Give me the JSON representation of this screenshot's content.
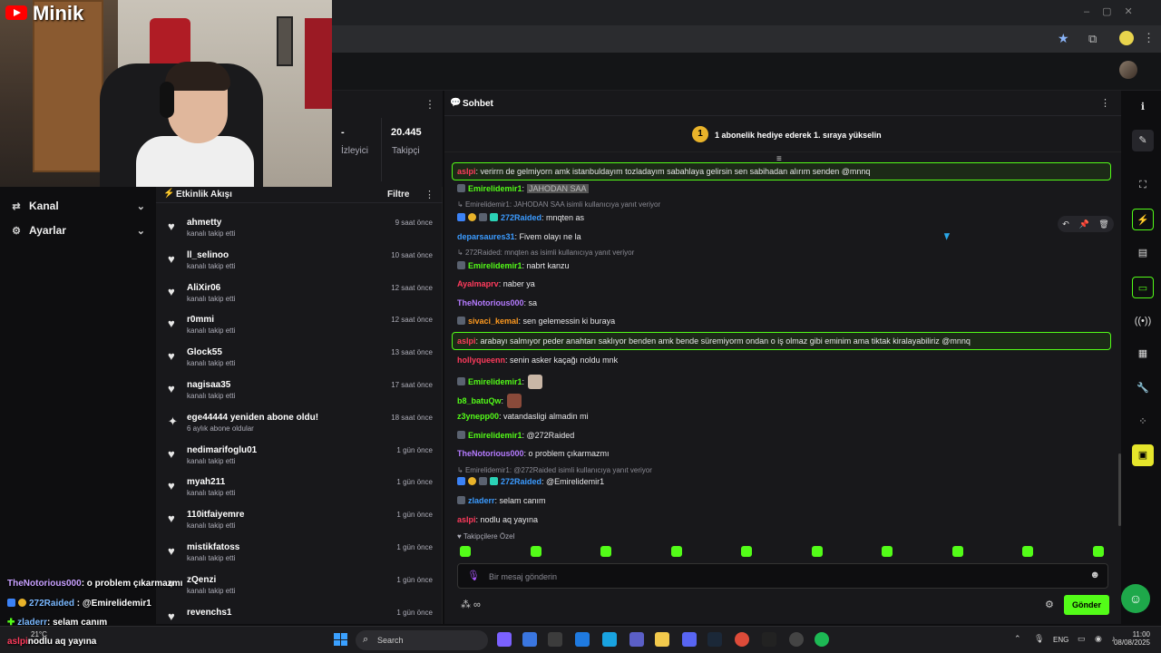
{
  "overlay": {
    "channel_name": "Minik",
    "chat_lines": [
      {
        "user": "TheNotorious000",
        "text": ": o problem çıkarmazmı"
      },
      {
        "user": "272Raided",
        "text": " : @Emirelidemir1"
      },
      {
        "user": "zladerr",
        "text": ": selam canım"
      },
      {
        "user": "aslpi",
        "text": "nodlu aq yayına"
      }
    ],
    "weather": "21°C"
  },
  "sidebar": {
    "items": [
      {
        "label": "Kanal"
      },
      {
        "label": "Ayarlar"
      }
    ]
  },
  "stats": {
    "viewers_value": "-",
    "viewers_label": "İzleyici",
    "followers_value": "20.445",
    "followers_label": "Takipçi"
  },
  "activity": {
    "title": "Etkinlik Akışı",
    "filter_label": "Filtre",
    "items": [
      {
        "name": "ahmetty",
        "sub": "kanalı takip etti",
        "time": "9 saat önce",
        "icon": "heart-icon"
      },
      {
        "name": "ll_selinoo",
        "sub": "kanalı takip etti",
        "time": "10 saat önce",
        "icon": "heart-icon"
      },
      {
        "name": "AliXir06",
        "sub": "kanalı takip etti",
        "time": "12 saat önce",
        "icon": "heart-icon"
      },
      {
        "name": "r0mmi",
        "sub": "kanalı takip etti",
        "time": "12 saat önce",
        "icon": "heart-icon"
      },
      {
        "name": "Glock55",
        "sub": "kanalı takip etti",
        "time": "13 saat önce",
        "icon": "heart-icon"
      },
      {
        "name": "nagisaa35",
        "sub": "kanalı takip etti",
        "time": "17 saat önce",
        "icon": "heart-icon"
      },
      {
        "name": "ege44444 yeniden abone oldu!",
        "sub": "6 aylık abone oldular",
        "time": "18 saat önce",
        "icon": "sparkle-icon"
      },
      {
        "name": "nedimarifoglu01",
        "sub": "kanalı takip etti",
        "time": "1 gün önce",
        "icon": "heart-icon"
      },
      {
        "name": "myah211",
        "sub": "kanalı takip etti",
        "time": "1 gün önce",
        "icon": "heart-icon"
      },
      {
        "name": "110itfaiyemre",
        "sub": "kanalı takip etti",
        "time": "1 gün önce",
        "icon": "heart-icon"
      },
      {
        "name": "mistikfatoss",
        "sub": "kanalı takip etti",
        "time": "1 gün önce",
        "icon": "heart-icon"
      },
      {
        "name": "zQenzi",
        "sub": "kanalı takip etti",
        "time": "1 gün önce",
        "icon": "heart-icon"
      },
      {
        "name": "revenchs1",
        "sub": "",
        "time": "1 gün önce",
        "icon": "heart-icon"
      }
    ]
  },
  "chat": {
    "title": "Sohbet",
    "gift_badge": "1",
    "gift_text": "1 abonelik hediye ederek 1. sıraya yükselin",
    "messages": [
      {
        "user": "aslpi",
        "color": "#ff3b5c",
        "text": ": verirrn de gelmiyorn amk istanbuldayım tozladayım sabahlaya gelirsin sen sabihadan alırım senden @mnnq"
      },
      {
        "user": "Emirelidemir1",
        "color": "#53fc18",
        "text": ":",
        "emote_text": "JAHODAN SAA"
      },
      {
        "reply": "Emirelidemir1: JAHODAN SAA isimli kullanıcıya yanıt veriyor"
      },
      {
        "user": "272Raided",
        "color": "#3b9bff",
        "text": ": mnqten as"
      },
      {
        "user": "deparsaures31",
        "color": "#3b9bff",
        "text": ": Fivem olayı ne la"
      },
      {
        "reply": "272Raided: mnqten as isimli kullanıcıya yanıt veriyor"
      },
      {
        "user": "Emirelidemir1",
        "color": "#53fc18",
        "text": ": nabrt kanzu"
      },
      {
        "user": "Ayalmaprv",
        "color": "#ff3b5c",
        "text": ": naber ya"
      },
      {
        "user": "TheNotorious000",
        "color": "#b57bff",
        "text": ": sa"
      },
      {
        "user": "sivaci_kemal",
        "color": "#ff9a1f",
        "text": ": sen gelemessin ki buraya"
      },
      {
        "user": "aslpi",
        "color": "#ff3b5c",
        "text": ": arabayı salmıyor peder anahtarı saklıyor benden amk bende süremiyorm ondan o iş olmaz gibi eminim ama tiktak kiralayabiliriz @mnnq"
      },
      {
        "user": "hollyqueenn",
        "color": "#ff3b5c",
        "text": ": senin asker kaçağı noldu mnk"
      },
      {
        "user": "Emirelidemir1",
        "color": "#53fc18",
        "text": ":"
      },
      {
        "user": "b8_batuQw",
        "color": "#53fc18",
        "text": ":"
      },
      {
        "user": "z3ynepp00",
        "color": "#53fc18",
        "text": ": vatandasligi almadin mi"
      },
      {
        "user": "Emirelidemir1",
        "color": "#53fc18",
        "text": ": @272Raided"
      },
      {
        "user": "TheNotorious000",
        "color": "#b57bff",
        "text": ": o problem çıkarmazmı"
      },
      {
        "reply": "Emirelidemir1: @272Raided isimli kullanıcıya yanıt veriyor"
      },
      {
        "user": "272Raided",
        "color": "#3b9bff",
        "text": ": @Emirelidemir1"
      },
      {
        "user": "zladerr",
        "color": "#3b9bff",
        "text": ": selam canım"
      },
      {
        "user": "aslpi",
        "color": "#ff3b5c",
        "text": ": nodlu aq yayına"
      }
    ],
    "follower_only": "Takipçilere Özel",
    "input_placeholder": "Bir mesaj gönderin",
    "send_label": "Gönder"
  },
  "taskbar": {
    "search_text": "Search",
    "lang": "ENG",
    "time": "11:00",
    "date": "08/08/2025"
  },
  "colors": {
    "accent": "#53fc18",
    "background": "#0e0e10",
    "panel": "#18181b"
  }
}
